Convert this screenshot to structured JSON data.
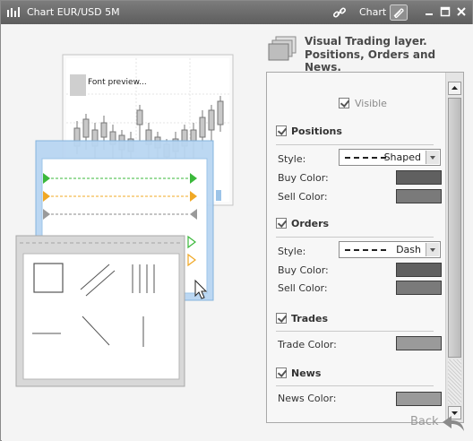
{
  "titlebar": {
    "title": "Chart EUR/USD 5M",
    "chart_label": "Chart"
  },
  "illustration": {
    "font_preview": "Font preview..."
  },
  "header": {
    "title": "Visual Trading layer.",
    "subtitle": "Positions, Orders and News."
  },
  "panel": {
    "visible_label": "Visible",
    "positions": {
      "title": "Positions",
      "style_label": "Style:",
      "style_value": "Shaped",
      "buy_label": "Buy Color:",
      "sell_label": "Sell Color:",
      "buy_color": "#606060",
      "sell_color": "#7a7a7a"
    },
    "orders": {
      "title": "Orders",
      "style_label": "Style:",
      "style_value": "Dash",
      "buy_label": "Buy Color:",
      "sell_label": "Sell Color:",
      "buy_color": "#606060",
      "sell_color": "#7a7a7a"
    },
    "trades": {
      "title": "Trades",
      "color_label": "Trade Color:",
      "color": "#9a9a9a"
    },
    "news": {
      "title": "News",
      "color_label": "News Color:"
    }
  },
  "back_label": "Back"
}
